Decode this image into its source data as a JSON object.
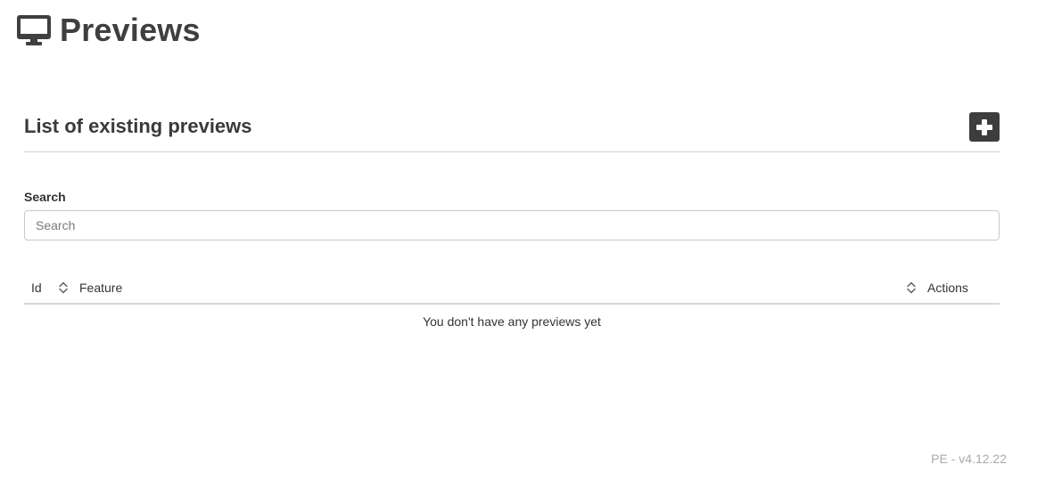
{
  "header": {
    "icon": "desktop-monitor-icon",
    "title": "Previews"
  },
  "section": {
    "title": "List of existing previews",
    "add_button_icon": "plus-icon"
  },
  "search": {
    "label": "Search",
    "placeholder": "Search",
    "value": ""
  },
  "table": {
    "columns": [
      {
        "label": "Id",
        "sortable": true
      },
      {
        "label": "Feature",
        "sortable": true
      },
      {
        "label": "Actions",
        "sortable": false
      }
    ],
    "rows": [],
    "empty_message": "You don't have any previews yet"
  },
  "footer": {
    "version": "PE - v4.12.22"
  },
  "colors": {
    "title": "#3f3f3f",
    "button_bg": "#3d3d3d",
    "divider": "#cfcfcf",
    "version_text": "#a9a9a9"
  }
}
